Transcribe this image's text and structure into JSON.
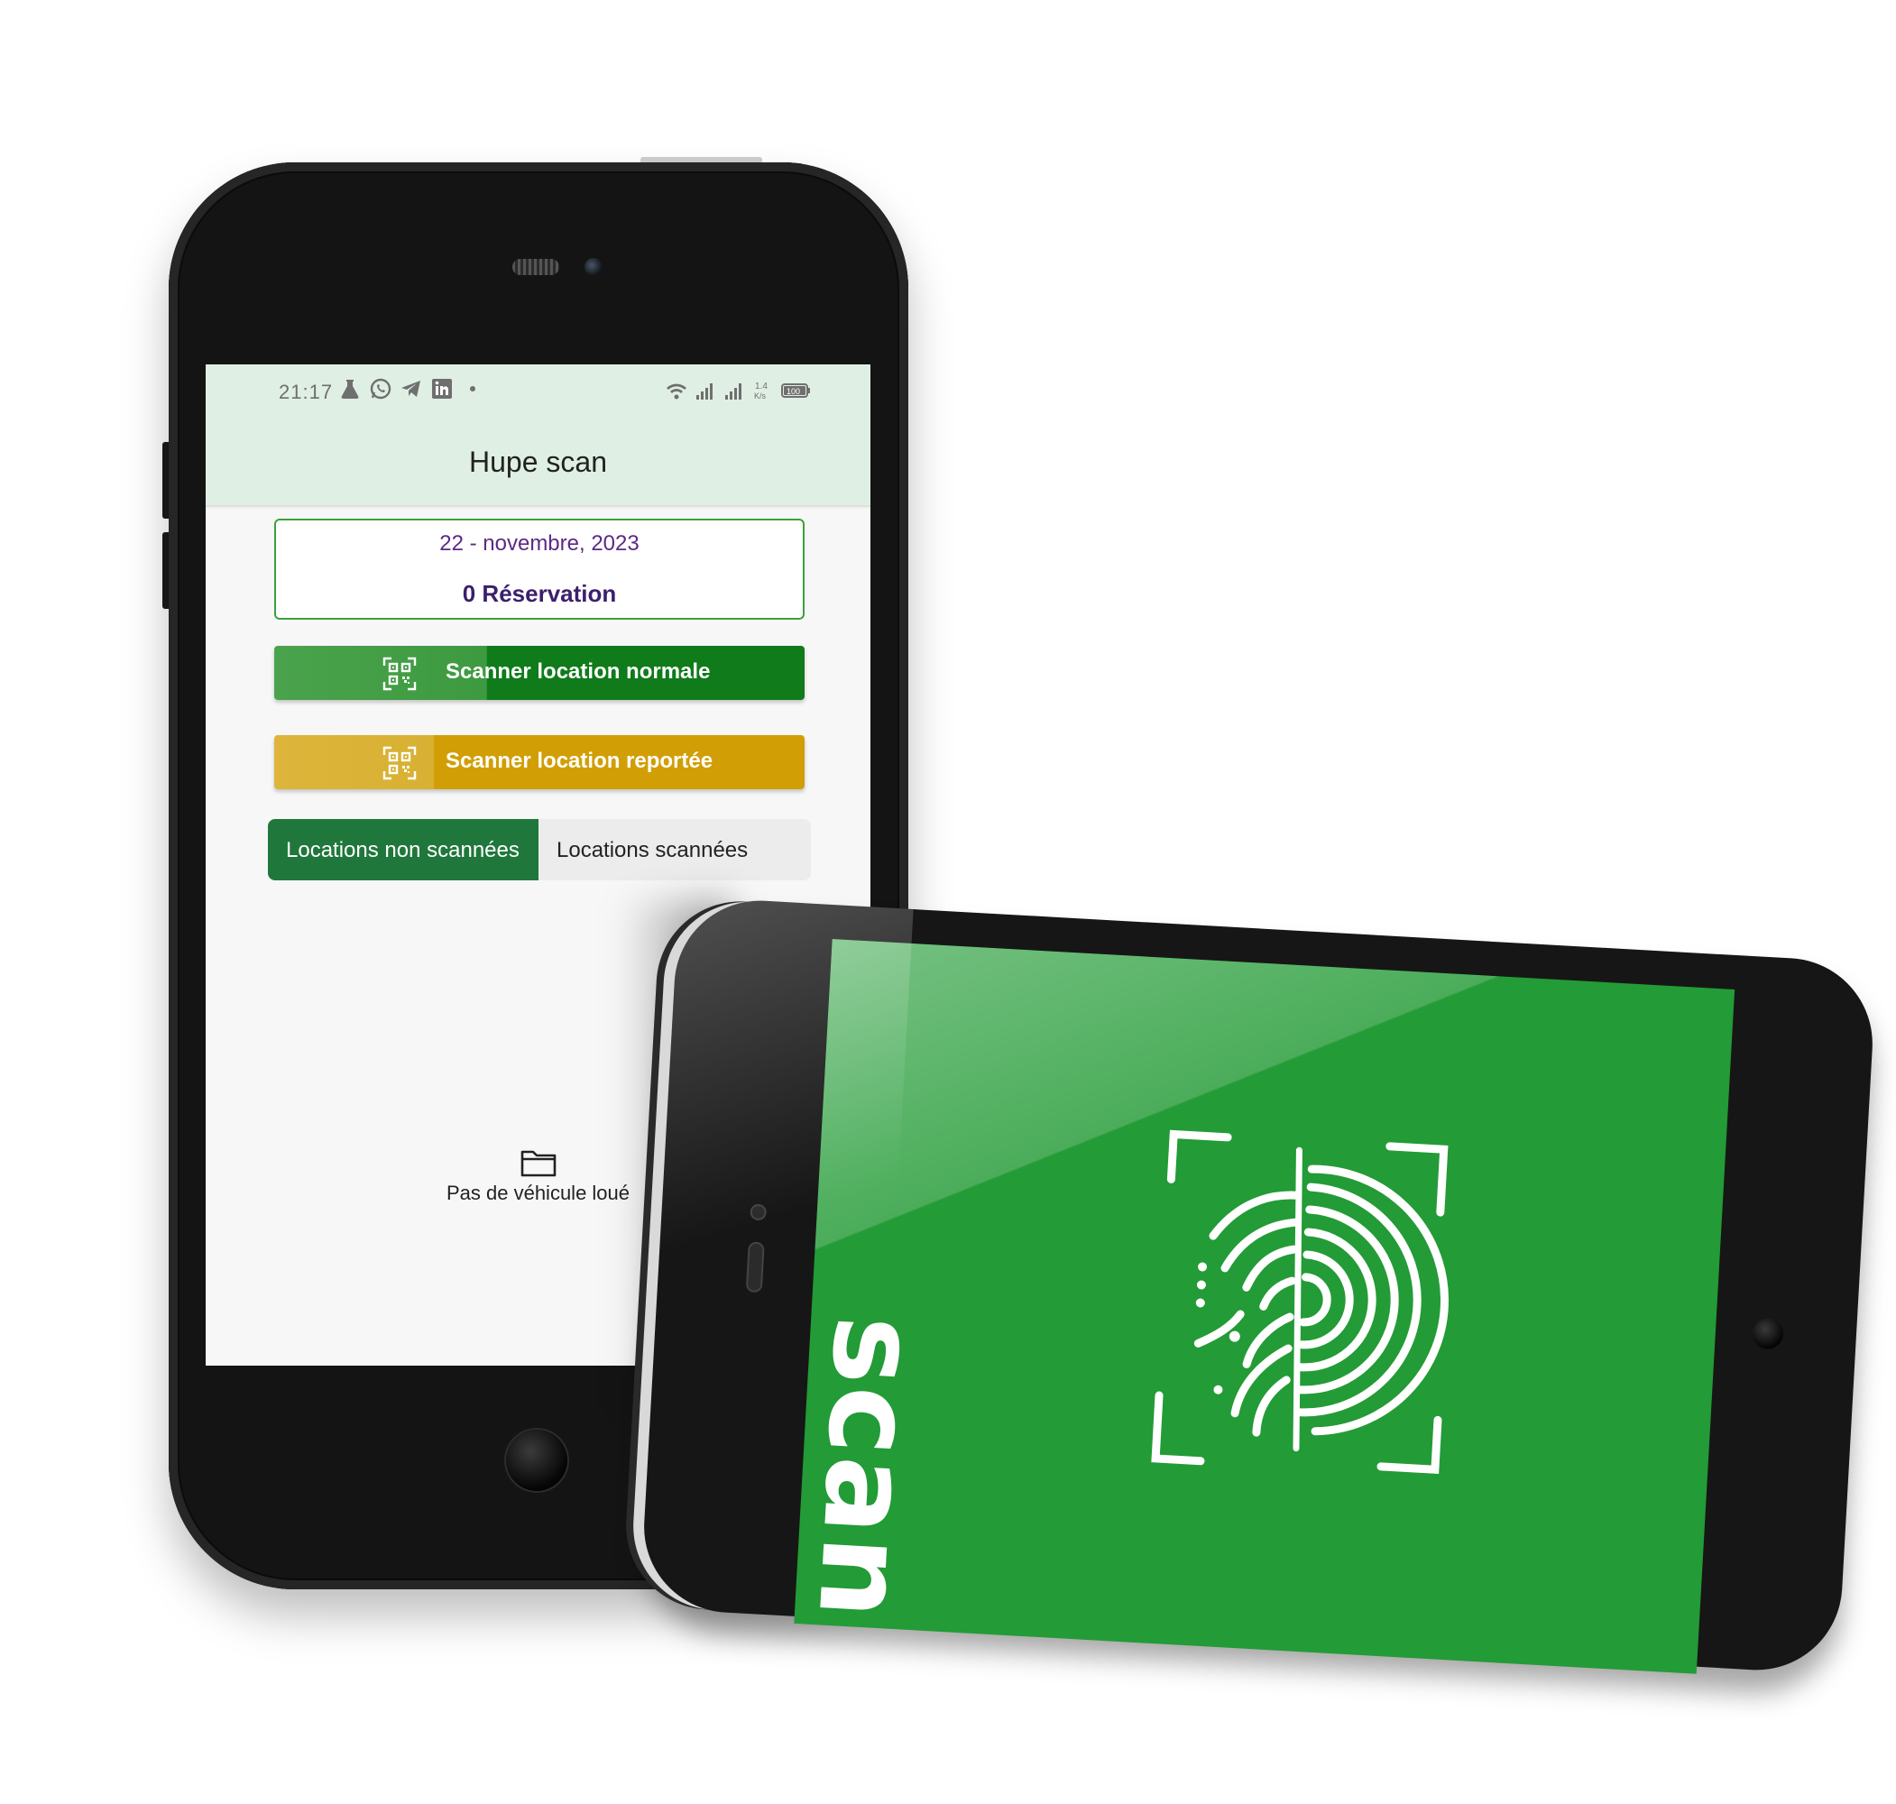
{
  "status_bar": {
    "time": "21:17",
    "left_icons": [
      "flask-icon",
      "whatsapp-icon",
      "telegram-icon",
      "linkedin-icon",
      "dot-icon"
    ],
    "right_icons": [
      "wifi-icon",
      "signal-icon",
      "signal-icon",
      "network-speed-icon",
      "battery-icon"
    ],
    "network_speed": "1.4\nK/s",
    "battery": "100"
  },
  "app": {
    "title": "Hupe scan"
  },
  "summary": {
    "date": "22 - novembre, 2023",
    "reservations": "0 Réservation"
  },
  "actions": {
    "scan_normal": "Scanner location normale",
    "scan_reported": "Scanner location reportée"
  },
  "tabs": [
    {
      "label": "Locations non scannées",
      "active": true
    },
    {
      "label": "Locations scannées",
      "active": false
    }
  ],
  "empty_state": {
    "icon": "folder-icon",
    "text": "Pas de véhicule loué"
  },
  "splash": {
    "word": "scan",
    "logo_icon": "fingerprint-icon",
    "background_color": "#239b36"
  },
  "colors": {
    "appbar": "#e0efe3",
    "primary_green": "#0f7b1a",
    "accent_yellow": "#d19f05",
    "tab_active": "#20773b",
    "date_text": "#5b2a86"
  }
}
